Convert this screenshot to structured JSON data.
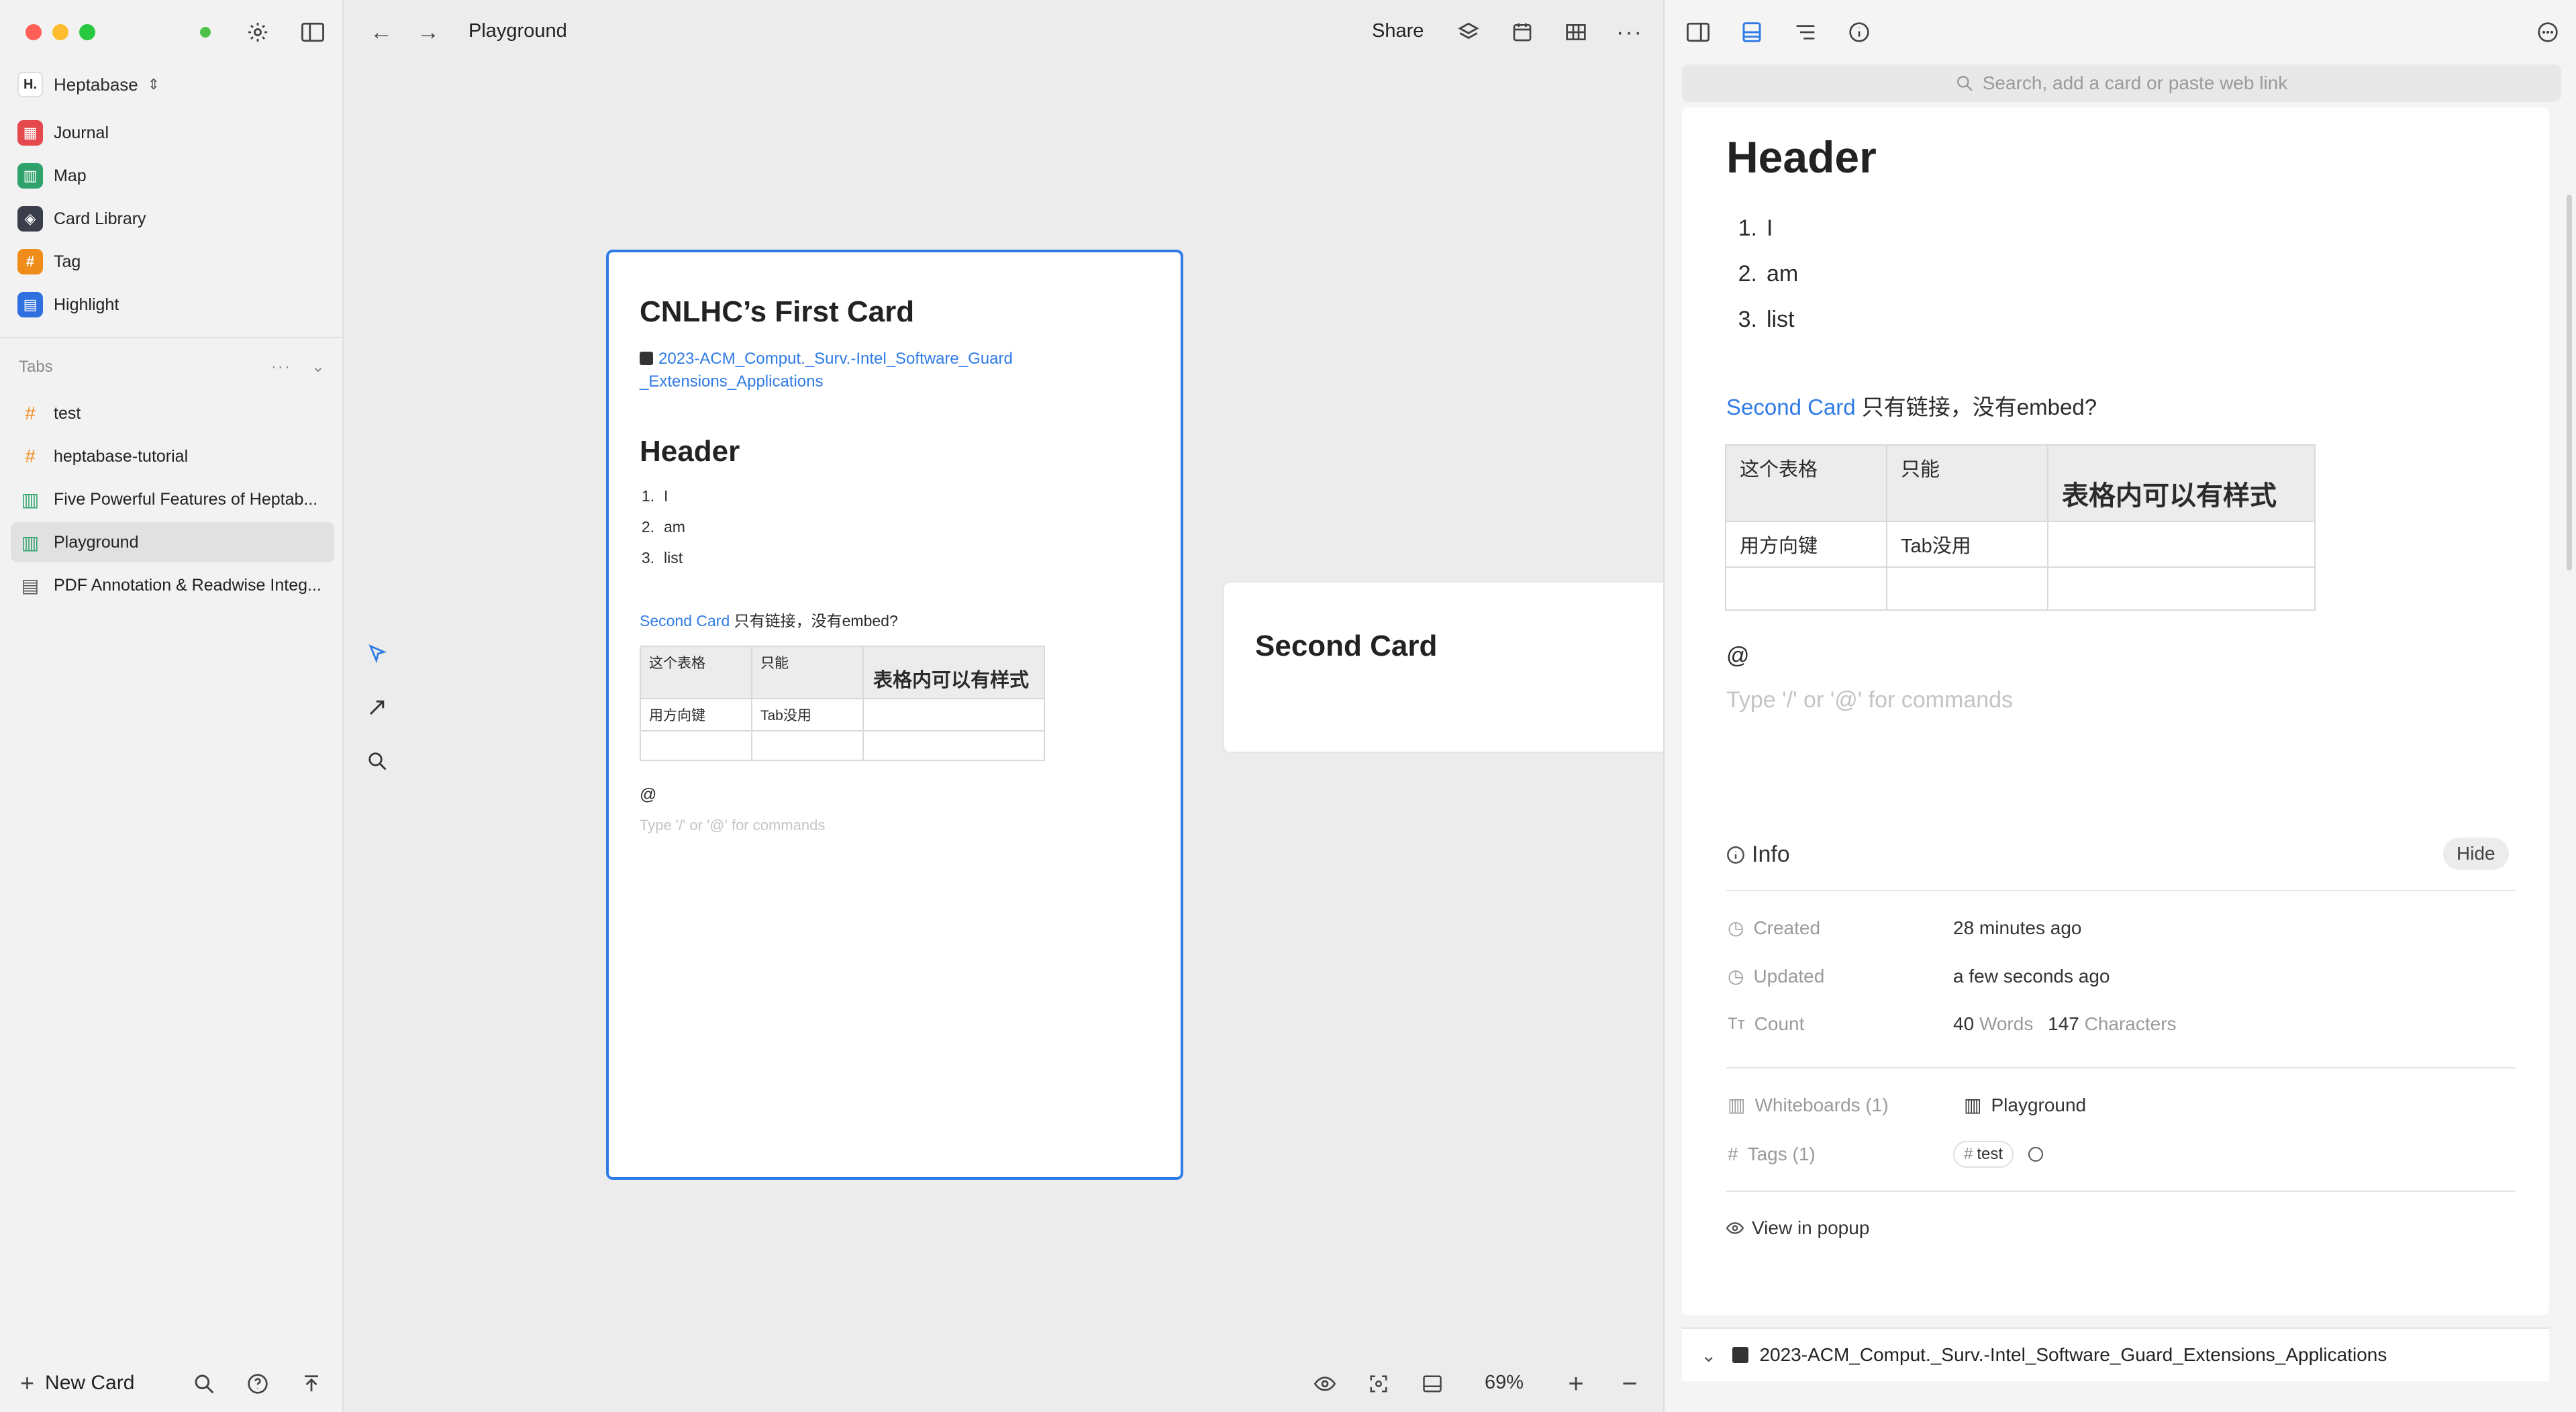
{
  "app": {
    "workspace": "Heptabase",
    "logo_letter": "H."
  },
  "sidebar": {
    "nav": [
      {
        "label": "Journal",
        "icon": "journal-icon",
        "color": "#e5484d",
        "glyph": "▦"
      },
      {
        "label": "Map",
        "icon": "map-icon",
        "color": "#2fa36b",
        "glyph": "▥"
      },
      {
        "label": "Card Library",
        "icon": "card-library-icon",
        "color": "#3a3f4b",
        "glyph": "◈"
      },
      {
        "label": "Tag",
        "icon": "tag-icon",
        "color": "#f08c1a",
        "glyph": "#"
      },
      {
        "label": "Highlight",
        "icon": "highlight-icon",
        "color": "#2f6fe0",
        "glyph": "▤"
      }
    ],
    "tabs_title": "Tabs",
    "tabs": [
      {
        "label": "test",
        "icon": "hashtag-icon",
        "glyph": "#",
        "color": "#f08c1a"
      },
      {
        "label": "heptabase-tutorial",
        "icon": "hashtag-icon",
        "glyph": "#",
        "color": "#f08c1a"
      },
      {
        "label": "Five Powerful Features of Heptab...",
        "icon": "whiteboard-icon",
        "glyph": "▥",
        "color": "#2fa36b"
      },
      {
        "label": "Playground",
        "icon": "whiteboard-icon",
        "glyph": "▥",
        "color": "#2fa36b",
        "active": true
      },
      {
        "label": "PDF Annotation & Readwise Integ...",
        "icon": "document-icon",
        "glyph": "▤",
        "color": "#555555"
      }
    ],
    "new_card": "New Card"
  },
  "toolbar": {
    "title": "Playground",
    "share": "Share",
    "zoom": "69%"
  },
  "card1": {
    "title": "CNLHC’s First Card",
    "pdf_link": "2023-ACM_Comput._Surv.-Intel_Software_Guard_Extensions_Applications",
    "header": "Header",
    "list": [
      {
        "n": "1.",
        "t": "I"
      },
      {
        "n": "2.",
        "t": "am"
      },
      {
        "n": "3.",
        "t": "list"
      }
    ],
    "link_text": "Second Card",
    "after_link": " 只有链接，没有embed?",
    "table_header": [
      "这个表格",
      "只能",
      "表格内可以有样式"
    ],
    "table_row": [
      "用方向键",
      "Tab没用",
      ""
    ],
    "at": "@",
    "placeholder": "Type '/' or '@' for commands"
  },
  "card2": {
    "title": "Second Card"
  },
  "right": {
    "search_placeholder": "Search, add a card or paste web link",
    "header": "Header",
    "list": [
      {
        "n": "1.",
        "t": "I"
      },
      {
        "n": "2.",
        "t": "am"
      },
      {
        "n": "3.",
        "t": "list"
      }
    ],
    "link_text": "Second Card",
    "after_link": " 只有链接，没有embed?",
    "table_header": [
      "这个表格",
      "只能",
      "表格内可以有样式"
    ],
    "table_row": [
      "用方向键",
      "Tab没用",
      ""
    ],
    "at": "@",
    "placeholder": "Type '/' or '@' for commands",
    "info": {
      "title": "Info",
      "hide": "Hide",
      "created_key": "Created",
      "created_val": "28 minutes ago",
      "updated_key": "Updated",
      "updated_val": "a few seconds ago",
      "count_key": "Count",
      "words_num": "40",
      "words_lbl": "Words",
      "chars_num": "147",
      "chars_lbl": "Characters",
      "whiteboards_key": "Whiteboards (1)",
      "whiteboards_val": "Playground",
      "tags_key": "Tags (1)",
      "tag_val": "test",
      "view_popup": "View in popup"
    },
    "pdf_bar": "2023-ACM_Comput._Surv.-Intel_Software_Guard_Extensions_Applications"
  }
}
